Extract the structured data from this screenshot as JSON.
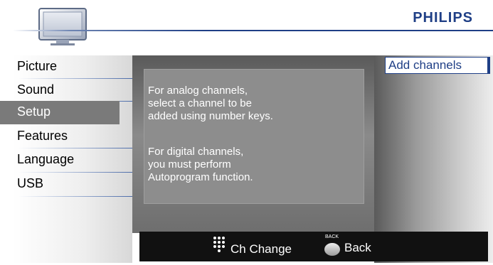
{
  "header": {
    "brand": "PHILIPS",
    "icon": "tv-monitor-icon",
    "accent_color": "#1f3f86"
  },
  "menu": {
    "items": [
      {
        "label": "Picture",
        "selected": false
      },
      {
        "label": "Sound",
        "selected": false
      },
      {
        "label": "Setup",
        "selected": true
      },
      {
        "label": "Features",
        "selected": false
      },
      {
        "label": "Language",
        "selected": false
      },
      {
        "label": "USB",
        "selected": false
      }
    ]
  },
  "info": {
    "analog_line1": "For analog channels,",
    "analog_line2": "select a channel to be",
    "analog_line3": "added using number keys.",
    "digital_line1": "For digital channels,",
    "digital_line2": "you must perform",
    "digital_line3": "Autoprogram function."
  },
  "submenu": {
    "selected_item": "Add channels"
  },
  "footer": {
    "numpad_icon": "numpad-dots-icon",
    "ch_change": "Ch Change",
    "back_button_label": "BACK",
    "back": "Back"
  }
}
